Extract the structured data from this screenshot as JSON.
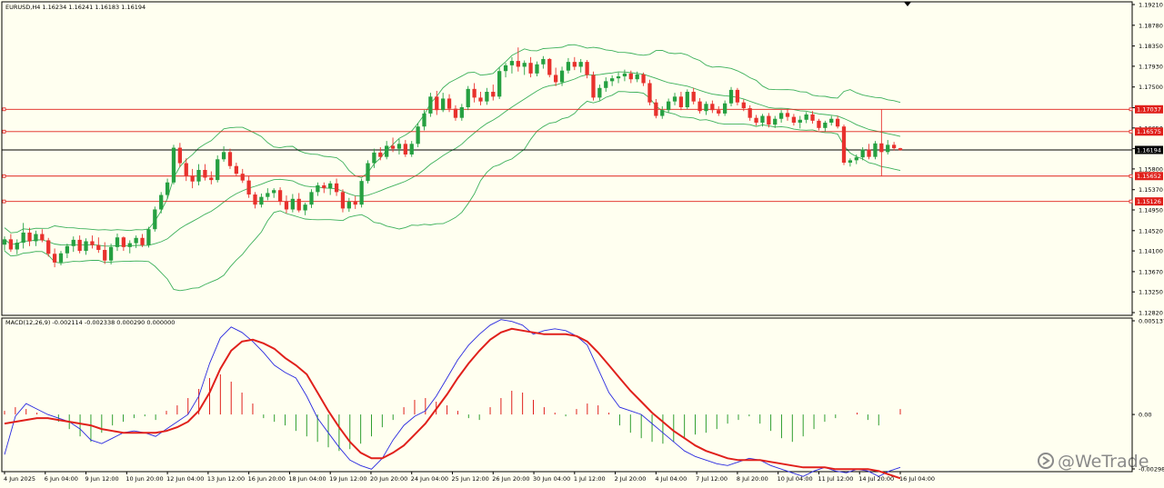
{
  "window": {
    "symbol_header": "EURUSD,H4  1.16234 1.16241 1.16183 1.16194",
    "watermark": "@WeTrade",
    "colors": {
      "background": "#fffff0",
      "bull_candle": "#26a041",
      "bear_candle": "#e8312d",
      "bollinger": "#3cb05a",
      "hline": "#e0201b",
      "price_line": "#000000",
      "macd_line": "#2a2ae0",
      "signal_line": "#e0201b",
      "hist_pos": "#e0201b",
      "hist_neg": "#2f9e2f"
    }
  },
  "chart_data": [
    {
      "type": "candlestick",
      "title": "EURUSD,H4",
      "ohlc_header": {
        "open": 1.16234,
        "high": 1.16241,
        "low": 1.16183,
        "close": 1.16194
      },
      "y_ticks": [
        "1.19210",
        "1.18780",
        "1.18350",
        "1.17930",
        "1.17500",
        "1.17070",
        "1.16650",
        "1.16220",
        "1.15800",
        "1.15370",
        "1.14950",
        "1.14520",
        "1.14100",
        "1.13670",
        "1.13250",
        "1.12820"
      ],
      "ylim": [
        1.1282,
        1.1921
      ],
      "x_tick_labels": [
        "4 Jun 2025",
        "6 Jun 04:00",
        "9 Jun 12:00",
        "10 Jun 20:00",
        "12 Jun 04:00",
        "13 Jun 12:00",
        "16 Jun 20:00",
        "18 Jun 04:00",
        "19 Jun 12:00",
        "20 Jun 20:00",
        "24 Jun 04:00",
        "25 Jun 12:00",
        "26 Jun 20:00",
        "30 Jun 04:00",
        "1 Jul 12:00",
        "2 Jul 20:00",
        "4 Jul 04:00",
        "7 Jul 12:00",
        "8 Jul 20:00",
        "10 Jul 04:00",
        "11 Jul 12:00",
        "14 Jul 20:00",
        "16 Jul 04:00"
      ],
      "horizontal_lines": [
        {
          "label": "1.17037",
          "value": 1.17037
        },
        {
          "label": "1.16575",
          "value": 1.16575
        },
        {
          "label": "1.16194",
          "value": 1.16194,
          "current": true
        },
        {
          "label": "1.15652",
          "value": 1.15652
        },
        {
          "label": "1.15126",
          "value": 1.15126
        }
      ],
      "candles": [
        [
          1.1423,
          1.144,
          1.1411,
          1.1434
        ],
        [
          1.1434,
          1.1445,
          1.1408,
          1.1413
        ],
        [
          1.1413,
          1.1434,
          1.1403,
          1.1427
        ],
        [
          1.1427,
          1.1468,
          1.1415,
          1.1448
        ],
        [
          1.1448,
          1.1458,
          1.142,
          1.143
        ],
        [
          1.143,
          1.1452,
          1.142,
          1.1445
        ],
        [
          1.1445,
          1.1455,
          1.1428,
          1.1432
        ],
        [
          1.1432,
          1.1437,
          1.1398,
          1.1404
        ],
        [
          1.1404,
          1.1415,
          1.1376,
          1.1386
        ],
        [
          1.1386,
          1.141,
          1.138,
          1.1405
        ],
        [
          1.1405,
          1.1425,
          1.1395,
          1.142
        ],
        [
          1.142,
          1.144,
          1.1408,
          1.1433
        ],
        [
          1.1433,
          1.1442,
          1.1405,
          1.141
        ],
        [
          1.141,
          1.1436,
          1.1402,
          1.143
        ],
        [
          1.143,
          1.1442,
          1.1415,
          1.1422
        ],
        [
          1.1422,
          1.1438,
          1.1406,
          1.1412
        ],
        [
          1.1412,
          1.1428,
          1.1383,
          1.139
        ],
        [
          1.139,
          1.1425,
          1.1382,
          1.1418
        ],
        [
          1.1418,
          1.1446,
          1.141,
          1.1438
        ],
        [
          1.1438,
          1.144,
          1.141,
          1.1418
        ],
        [
          1.1418,
          1.1432,
          1.1405,
          1.1426
        ],
        [
          1.1426,
          1.1442,
          1.1416,
          1.1437
        ],
        [
          1.1437,
          1.1445,
          1.1418,
          1.1422
        ],
        [
          1.1422,
          1.146,
          1.1417,
          1.1455
        ],
        [
          1.1455,
          1.1502,
          1.145,
          1.1496
        ],
        [
          1.1496,
          1.1532,
          1.1488,
          1.1526
        ],
        [
          1.1526,
          1.156,
          1.1518,
          1.1552
        ],
        [
          1.1552,
          1.163,
          1.1548,
          1.1624
        ],
        [
          1.1624,
          1.1634,
          1.1584,
          1.1592
        ],
        [
          1.1592,
          1.1602,
          1.1555,
          1.1566
        ],
        [
          1.1566,
          1.158,
          1.154,
          1.1554
        ],
        [
          1.1554,
          1.159,
          1.1546,
          1.1578
        ],
        [
          1.1578,
          1.159,
          1.1556,
          1.1562
        ],
        [
          1.1562,
          1.1575,
          1.1548,
          1.1557
        ],
        [
          1.1557,
          1.1608,
          1.1552,
          1.16
        ],
        [
          1.16,
          1.1627,
          1.1595,
          1.1615
        ],
        [
          1.1615,
          1.1622,
          1.158,
          1.1586
        ],
        [
          1.1586,
          1.1593,
          1.1565,
          1.157
        ],
        [
          1.157,
          1.158,
          1.1551,
          1.1556
        ],
        [
          1.1556,
          1.1565,
          1.152,
          1.1527
        ],
        [
          1.1527,
          1.1532,
          1.1498,
          1.1506
        ],
        [
          1.1506,
          1.1529,
          1.15,
          1.1522
        ],
        [
          1.1522,
          1.154,
          1.1515,
          1.153
        ],
        [
          1.153,
          1.154,
          1.152,
          1.1536
        ],
        [
          1.1536,
          1.1542,
          1.1505,
          1.1512
        ],
        [
          1.1512,
          1.1525,
          1.1488,
          1.1496
        ],
        [
          1.1496,
          1.1528,
          1.149,
          1.1518
        ],
        [
          1.1518,
          1.153,
          1.149,
          1.1494
        ],
        [
          1.1494,
          1.151,
          1.1484,
          1.1506
        ],
        [
          1.1506,
          1.1538,
          1.1499,
          1.1532
        ],
        [
          1.1532,
          1.1552,
          1.1524,
          1.1546
        ],
        [
          1.1546,
          1.1552,
          1.153,
          1.154
        ],
        [
          1.154,
          1.1555,
          1.1526,
          1.155
        ],
        [
          1.155,
          1.156,
          1.1524,
          1.1532
        ],
        [
          1.1532,
          1.1538,
          1.149,
          1.1498
        ],
        [
          1.1498,
          1.152,
          1.1491,
          1.1512
        ],
        [
          1.1512,
          1.1524,
          1.1497,
          1.1506
        ],
        [
          1.1506,
          1.156,
          1.15,
          1.1555
        ],
        [
          1.1555,
          1.1598,
          1.155,
          1.1592
        ],
        [
          1.1592,
          1.1622,
          1.1582,
          1.1614
        ],
        [
          1.1614,
          1.1625,
          1.1598,
          1.1605
        ],
        [
          1.1605,
          1.1638,
          1.16,
          1.1628
        ],
        [
          1.1628,
          1.1645,
          1.1615,
          1.1622
        ],
        [
          1.1622,
          1.1642,
          1.161,
          1.1632
        ],
        [
          1.1632,
          1.164,
          1.1605,
          1.161
        ],
        [
          1.161,
          1.1638,
          1.1605,
          1.1632
        ],
        [
          1.1632,
          1.1675,
          1.1625,
          1.1668
        ],
        [
          1.1668,
          1.1702,
          1.166,
          1.1695
        ],
        [
          1.1695,
          1.1738,
          1.1688,
          1.173
        ],
        [
          1.173,
          1.1742,
          1.1692,
          1.1702
        ],
        [
          1.1702,
          1.1738,
          1.1698,
          1.1726
        ],
        [
          1.1726,
          1.1735,
          1.1698,
          1.1705
        ],
        [
          1.1705,
          1.1712,
          1.168,
          1.1686
        ],
        [
          1.1686,
          1.1715,
          1.168,
          1.1708
        ],
        [
          1.1708,
          1.1752,
          1.1702,
          1.1746
        ],
        [
          1.1746,
          1.1758,
          1.1718,
          1.1728
        ],
        [
          1.1728,
          1.174,
          1.1712,
          1.172
        ],
        [
          1.172,
          1.1748,
          1.1713,
          1.174
        ],
        [
          1.174,
          1.1755,
          1.1722,
          1.173
        ],
        [
          1.173,
          1.179,
          1.1725,
          1.1783
        ],
        [
          1.1783,
          1.18,
          1.177,
          1.1795
        ],
        [
          1.1795,
          1.1812,
          1.1778,
          1.1804
        ],
        [
          1.1804,
          1.1832,
          1.1782,
          1.1792
        ],
        [
          1.1792,
          1.1805,
          1.1775,
          1.18
        ],
        [
          1.18,
          1.1812,
          1.177,
          1.1778
        ],
        [
          1.1778,
          1.1803,
          1.1772,
          1.1797
        ],
        [
          1.1797,
          1.1814,
          1.1788,
          1.1808
        ],
        [
          1.1808,
          1.181,
          1.177,
          1.1775
        ],
        [
          1.1775,
          1.179,
          1.1752,
          1.176
        ],
        [
          1.176,
          1.1792,
          1.1752,
          1.1784
        ],
        [
          1.1784,
          1.181,
          1.1778,
          1.1802
        ],
        [
          1.1802,
          1.1812,
          1.1785,
          1.1792
        ],
        [
          1.1792,
          1.1808,
          1.178,
          1.1802
        ],
        [
          1.1802,
          1.1806,
          1.1768,
          1.1775
        ],
        [
          1.1775,
          1.1782,
          1.1722,
          1.1728
        ],
        [
          1.1728,
          1.1755,
          1.1722,
          1.1748
        ],
        [
          1.1748,
          1.177,
          1.174,
          1.1762
        ],
        [
          1.1762,
          1.1774,
          1.1752,
          1.1768
        ],
        [
          1.1768,
          1.178,
          1.1758,
          1.1772
        ],
        [
          1.1772,
          1.1786,
          1.1762,
          1.1778
        ],
        [
          1.1778,
          1.1784,
          1.1758,
          1.1766
        ],
        [
          1.1766,
          1.1782,
          1.176,
          1.1776
        ],
        [
          1.1776,
          1.178,
          1.1752,
          1.1758
        ],
        [
          1.1758,
          1.1765,
          1.1712,
          1.1718
        ],
        [
          1.1718,
          1.1725,
          1.1685,
          1.169
        ],
        [
          1.169,
          1.171,
          1.1684,
          1.1702
        ],
        [
          1.1702,
          1.1726,
          1.1696,
          1.172
        ],
        [
          1.172,
          1.1738,
          1.1712,
          1.173
        ],
        [
          1.173,
          1.174,
          1.1702,
          1.1708
        ],
        [
          1.1708,
          1.1745,
          1.1704,
          1.174
        ],
        [
          1.174,
          1.1748,
          1.1714,
          1.172
        ],
        [
          1.172,
          1.1727,
          1.1695,
          1.17
        ],
        [
          1.17,
          1.172,
          1.1692,
          1.1715
        ],
        [
          1.1715,
          1.1722,
          1.1696,
          1.1702
        ],
        [
          1.1702,
          1.171,
          1.169,
          1.1695
        ],
        [
          1.1695,
          1.1722,
          1.169,
          1.1716
        ],
        [
          1.1716,
          1.175,
          1.171,
          1.1744
        ],
        [
          1.1744,
          1.1748,
          1.1712,
          1.1718
        ],
        [
          1.1718,
          1.1724,
          1.17,
          1.1706
        ],
        [
          1.1706,
          1.1712,
          1.168,
          1.1686
        ],
        [
          1.1686,
          1.1692,
          1.167,
          1.1676
        ],
        [
          1.1676,
          1.1694,
          1.1668,
          1.169
        ],
        [
          1.169,
          1.1696,
          1.1666,
          1.1672
        ],
        [
          1.1672,
          1.169,
          1.1665,
          1.1684
        ],
        [
          1.1684,
          1.1702,
          1.1676,
          1.1696
        ],
        [
          1.1696,
          1.1704,
          1.168,
          1.1688
        ],
        [
          1.1688,
          1.1694,
          1.167,
          1.1676
        ],
        [
          1.1676,
          1.169,
          1.1664,
          1.1682
        ],
        [
          1.1682,
          1.1698,
          1.1675,
          1.1693
        ],
        [
          1.1693,
          1.17,
          1.1674,
          1.168
        ],
        [
          1.168,
          1.1684,
          1.166,
          1.1665
        ],
        [
          1.1665,
          1.168,
          1.1658,
          1.1676
        ],
        [
          1.1676,
          1.169,
          1.167,
          1.1684
        ],
        [
          1.1684,
          1.169,
          1.1664,
          1.1668
        ],
        [
          1.1668,
          1.1672,
          1.1588,
          1.1593
        ],
        [
          1.1593,
          1.1602,
          1.1585,
          1.1598
        ],
        [
          1.1598,
          1.161,
          1.159,
          1.1604
        ],
        [
          1.1604,
          1.1625,
          1.1598,
          1.162
        ],
        [
          1.162,
          1.1632,
          1.16,
          1.1605
        ],
        [
          1.1605,
          1.1638,
          1.16,
          1.1633
        ],
        [
          1.1633,
          1.1703,
          1.1565,
          1.1615
        ],
        [
          1.1615,
          1.164,
          1.161,
          1.163
        ],
        [
          1.163,
          1.1636,
          1.1618,
          1.1623
        ],
        [
          1.1623,
          1.1624,
          1.1618,
          1.1619
        ]
      ]
    },
    {
      "type": "macd",
      "title": "MACD(12,26,9) -0.002114 -0.002338 0.000290 0.000000",
      "y_ticks": [
        "0.005137",
        "0.00",
        "-0.002985"
      ],
      "ylim": [
        -0.002985,
        0.005137
      ],
      "series_macd": [
        -0.0022,
        -0.0001,
        0.0006,
        0.0003,
        0.0,
        -0.0002,
        -0.0004,
        -0.0008,
        -0.0014,
        -0.0016,
        -0.0013,
        -0.001,
        -0.0009,
        -0.001,
        -0.0012,
        -0.0008,
        -0.0004,
        0.0,
        0.001,
        0.0028,
        0.0042,
        0.0048,
        0.0045,
        0.004,
        0.0034,
        0.0027,
        0.0023,
        0.002,
        0.001,
        -0.0002,
        -0.001,
        -0.0018,
        -0.0025,
        -0.0028,
        -0.003,
        -0.0024,
        -0.0014,
        -0.0006,
        -0.0001,
        0.0002,
        0.001,
        0.002,
        0.003,
        0.0038,
        0.0044,
        0.0049,
        0.0052,
        0.0051,
        0.0049,
        0.0044,
        0.0046,
        0.0047,
        0.0046,
        0.0043,
        0.0038,
        0.0025,
        0.0012,
        0.0004,
        0.0002,
        0.0,
        -0.0005,
        -0.001,
        -0.0015,
        -0.002,
        -0.0023,
        -0.0025,
        -0.0027,
        -0.0028,
        -0.0026,
        -0.0024,
        -0.0025,
        -0.0028,
        -0.003,
        -0.0032,
        -0.0034,
        -0.0031,
        -0.0029,
        -0.0031,
        -0.0032,
        -0.003,
        -0.0031,
        -0.0034,
        -0.0031,
        -0.0029
      ],
      "series_signal": [
        -0.0005,
        -0.0004,
        -0.0003,
        -0.0002,
        -0.0002,
        -0.0003,
        -0.0004,
        -0.0005,
        -0.0006,
        -0.0008,
        -0.0009,
        -0.001,
        -0.001,
        -0.001,
        -0.001,
        -0.0009,
        -0.0007,
        -0.0004,
        0.0002,
        0.0012,
        0.0025,
        0.0035,
        0.004,
        0.0041,
        0.0039,
        0.0036,
        0.0031,
        0.0027,
        0.0022,
        0.0012,
        0.0002,
        -0.0007,
        -0.0015,
        -0.0021,
        -0.0024,
        -0.0024,
        -0.0021,
        -0.0017,
        -0.0011,
        -0.0005,
        0.0003,
        0.0011,
        0.002,
        0.0028,
        0.0035,
        0.0041,
        0.0045,
        0.0047,
        0.0046,
        0.0045,
        0.0044,
        0.0044,
        0.0044,
        0.0043,
        0.004,
        0.0034,
        0.0027,
        0.002,
        0.0013,
        0.0007,
        0.0001,
        -0.0004,
        -0.0009,
        -0.0013,
        -0.0017,
        -0.002,
        -0.0022,
        -0.0024,
        -0.0025,
        -0.0025,
        -0.0025,
        -0.0026,
        -0.0027,
        -0.0028,
        -0.0029,
        -0.0029,
        -0.0029,
        -0.003,
        -0.003,
        -0.003,
        -0.003,
        -0.0031,
        -0.0033,
        -0.0035
      ],
      "histogram": [
        0.0002,
        0.0004,
        0.0003,
        0.0001,
        0.0,
        -0.0004,
        -0.0008,
        -0.0012,
        -0.0015,
        -0.001,
        -0.0006,
        -0.0004,
        -0.0002,
        -0.0001,
        -0.0003,
        0.0002,
        0.0005,
        0.0009,
        0.0014,
        0.002,
        0.0022,
        0.0018,
        0.0012,
        0.0006,
        -0.0002,
        -0.0004,
        -0.0006,
        -0.0009,
        -0.0012,
        -0.0015,
        -0.0018,
        -0.002,
        -0.0019,
        -0.0016,
        -0.0012,
        -0.0007,
        -0.0003,
        0.0004,
        0.0008,
        0.0009,
        0.0007,
        0.0005,
        0.0002,
        -0.0002,
        -0.0003,
        0.0004,
        0.0009,
        0.0013,
        0.0012,
        0.0008,
        0.0004,
        0.0001,
        -0.0001,
        0.0003,
        0.0006,
        0.0005,
        0.0001,
        -0.0006,
        -0.001,
        -0.0013,
        -0.0015,
        -0.0016,
        -0.0015,
        -0.0013,
        -0.0011,
        -0.001,
        -0.0008,
        -0.0005,
        -0.0003,
        -0.0001,
        -0.0005,
        -0.0009,
        -0.0013,
        -0.0015,
        -0.0012,
        -0.0008,
        -0.0004,
        -0.0002,
        0.0,
        0.0001,
        -0.0003,
        -0.0006,
        0.0,
        0.0003
      ]
    }
  ]
}
